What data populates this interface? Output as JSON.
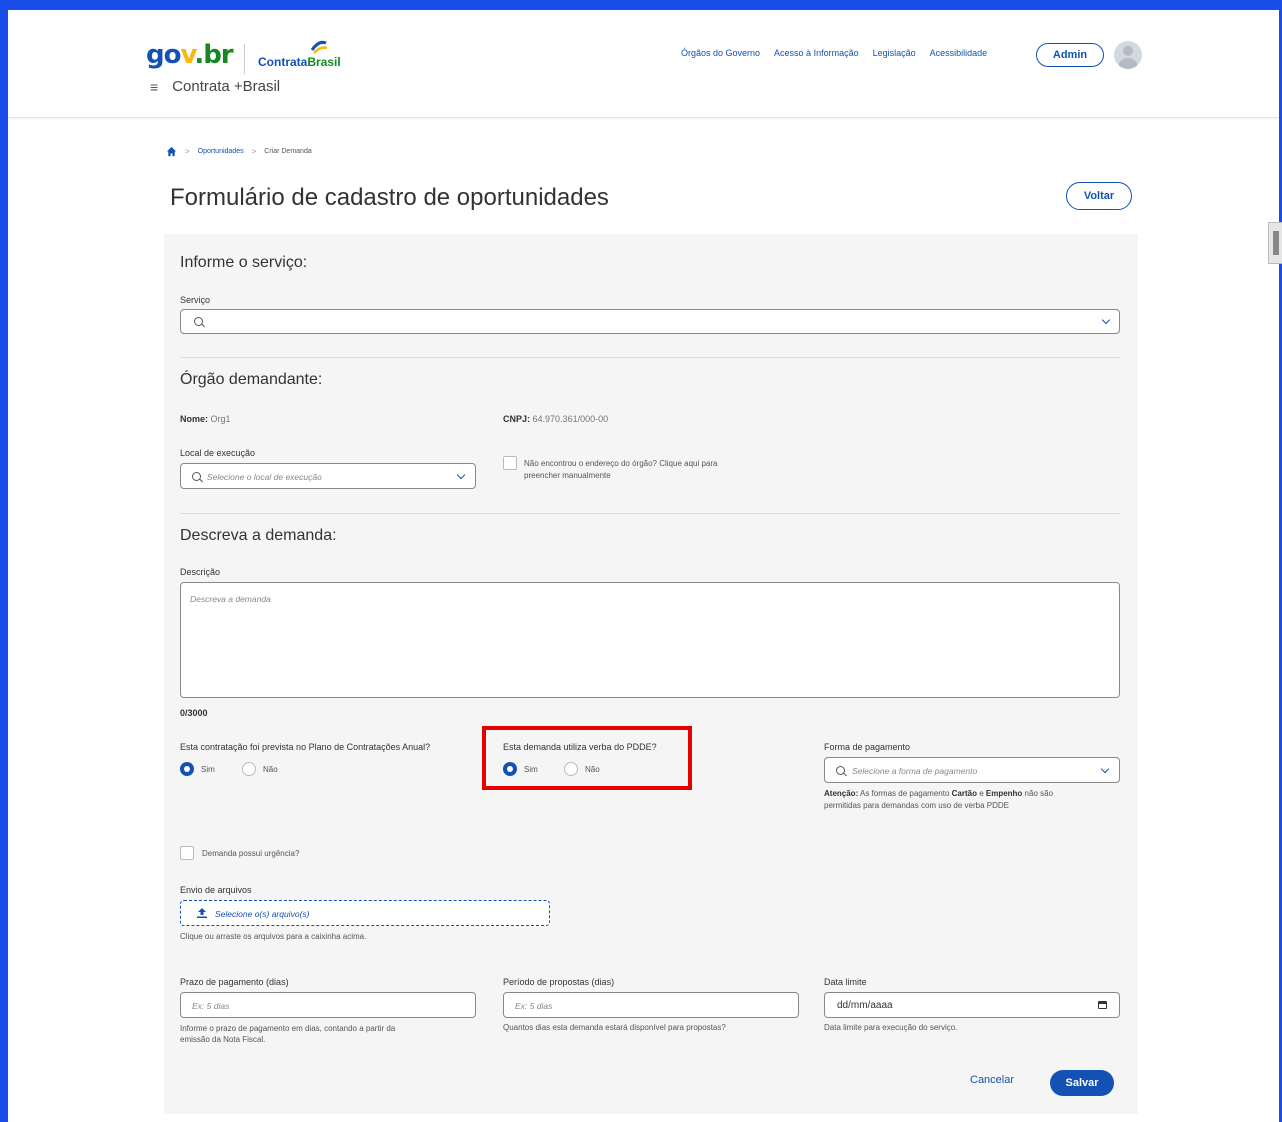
{
  "header": {
    "logo_gov_1": "go",
    "logo_gov_2": "v",
    "logo_gov_3": ".br",
    "logo_contrata_1": "Contrata",
    "logo_contrata_2": "Brasil",
    "menu_icon": "≡",
    "app_name": "Contrata +Brasil",
    "links": [
      "Órgãos do Governo",
      "Acesso à Informação",
      "Legislação",
      "Acessibilidade"
    ],
    "admin_label": "Admin"
  },
  "breadcrumb": {
    "items": [
      "Oportunidades",
      "Criar Demanda"
    ]
  },
  "page": {
    "title": "Formulário de cadastro de oportunidades",
    "back_label": "Voltar"
  },
  "servico": {
    "section_title": "Informe o serviço:",
    "label": "Serviço",
    "value": ""
  },
  "orgao": {
    "section_title": "Órgão demandante:",
    "nome_label": "Nome:",
    "nome_value": "Org1",
    "cnpj_label": "CNPJ:",
    "cnpj_value": "64.970.361/000-00",
    "local_label": "Local de execução",
    "local_placeholder": "Selecione o local de execução",
    "manual_checkbox_label_1": "Não encontrou o endereço do órgão? Clique aqui para",
    "manual_checkbox_label_2": "preencher manualmente"
  },
  "demanda": {
    "section_title": "Descreva a demanda:",
    "descricao_label": "Descrição",
    "descricao_placeholder": "Descreva a demanda",
    "counter": "0/3000",
    "pca_question": "Esta contratação foi prevista no Plano de Contratações Anual?",
    "pca_yes": "Sim",
    "pca_no": "Não",
    "pdde_question": "Esta demanda utiliza verba do PDDE?",
    "pdde_yes": "Sim",
    "pdde_no": "Não",
    "pagamento_label": "Forma de pagamento",
    "pagamento_placeholder": "Selecione a forma de pagamento",
    "atencao_bold": "Atenção:",
    "atencao_text_1": " As formas de pagamento ",
    "atencao_cartao": "Cartão",
    "atencao_e": " e ",
    "atencao_empenho": "Empenho",
    "atencao_text_2": " não são",
    "atencao_text_3": "permitidas para demandas com uso de verba PDDE",
    "urgencia_label": "Demanda possui urgência?",
    "arquivos_label": "Envio de arquivos",
    "arquivos_placeholder": "Selecione o(s) arquivo(s)",
    "arquivos_help": "Clique ou arraste os arquivos para a caixinha acima.",
    "prazo_label": "Prazo de pagamento (dias)",
    "prazo_placeholder": "Ex: 5 dias",
    "prazo_help_1": "Informe o prazo de pagamento em dias, contando a partir da",
    "prazo_help_2": "emissão da Nota Fiscal.",
    "periodo_label": "Período de propostas (dias)",
    "periodo_placeholder": "Ex: 5 dias",
    "periodo_help": "Quantos dias esta demanda estará disponível para propostas?",
    "data_label": "Data limite",
    "data_placeholder": "dd/mm/aaaa",
    "data_help": "Data limite para execução do serviço."
  },
  "actions": {
    "cancel_label": "Cancelar",
    "save_label": "Salvar"
  },
  "colors": {
    "primary": "#1351b4",
    "frame": "#1a4ee8",
    "highlight": "#e50000"
  }
}
